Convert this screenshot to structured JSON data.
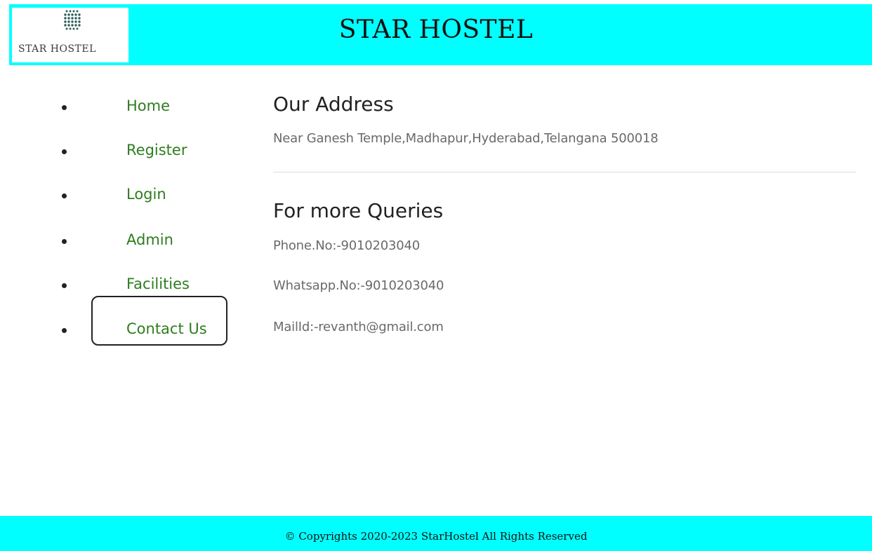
{
  "header": {
    "title": "STAR HOSTEL",
    "logo_text": "STAR HOSTEL",
    "background": "#00ffff"
  },
  "nav": {
    "items": [
      {
        "label": "Home"
      },
      {
        "label": "Register"
      },
      {
        "label": "Login"
      },
      {
        "label": "Admin"
      },
      {
        "label": "Facilities"
      },
      {
        "label": "Contact Us",
        "focused": true
      }
    ],
    "link_color": "#2e7d1f"
  },
  "main": {
    "address_heading": "Our Address",
    "address_text": "Near Ganesh Temple,Madhapur,Hyderabad,Telangana 500018",
    "queries_heading": "For more Queries",
    "phone": "Phone.No:-9010203040",
    "whatsapp": "Whatsapp.No:-9010203040",
    "mail": "MailId:-revanth@gmail.com"
  },
  "footer": {
    "text": "© Copyrights 2020-2023 StarHostel All Rights Reserved",
    "background": "#00ffff"
  }
}
